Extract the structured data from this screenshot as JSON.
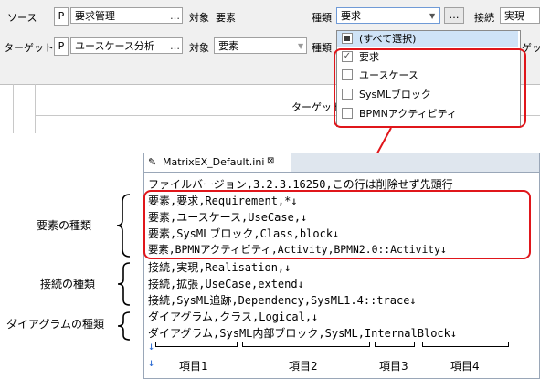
{
  "dialog": {
    "source_label": "ソース",
    "source_p": "P",
    "source_value": "要求管理",
    "ellipsis": "…",
    "object_label": "対象",
    "source_object": "要素",
    "kind_label": "種類",
    "kind_value": "要求",
    "kind_dots": "…",
    "connect_label": "接続",
    "connect_value": "実現",
    "target_label": "ターゲット",
    "target_p": "P",
    "target_value": "ユースケース分析",
    "target_object": "要素",
    "kind_label2": "種類",
    "grid_header": "ターゲット",
    "cut_text": "ゲッ"
  },
  "dropdown": {
    "items": [
      {
        "label": "(すべて選択)",
        "state": "partial"
      },
      {
        "label": "要求",
        "state": "checked"
      },
      {
        "label": "ユースケース",
        "state": "unchecked"
      },
      {
        "label": "SysMLブロック",
        "state": "unchecked"
      },
      {
        "label": "BPMNアクティビティ",
        "state": "unchecked"
      }
    ]
  },
  "editor": {
    "tab_title": "MatrixEX_Default.ini",
    "tab_close": "⊠",
    "lines": [
      "ファイルバージョン,3.2.3.16250,この行は削除せず先頭行",
      "要素,要求,Requirement,*↓",
      "要素,ユースケース,UseCase,↓",
      "要素,SysMLブロック,Class,block↓",
      "要素,BPMNアクティビティ,Activity,BPMN2.0::Activity↓",
      "接続,実現,Realisation,↓",
      "接続,拡張,UseCase,extend↓",
      "接続,SysML追跡,Dependency,SysML1.4::trace↓",
      "ダイアグラム,クラス,Logical,↓",
      "ダイアグラム,SysML内部ブロック,SysML,InternalBlock↓",
      "↓",
      "↓"
    ]
  },
  "annotations": {
    "element_kind": "要素の種類",
    "connect_kind": "接続の種類",
    "diagram_kind": "ダイアグラムの種類",
    "item1": "項目1",
    "item2": "項目2",
    "item3": "項目3",
    "item4": "項目4"
  },
  "colors": {
    "highlight": "#e0161b",
    "arrow_mark": "#2a6ad2"
  }
}
